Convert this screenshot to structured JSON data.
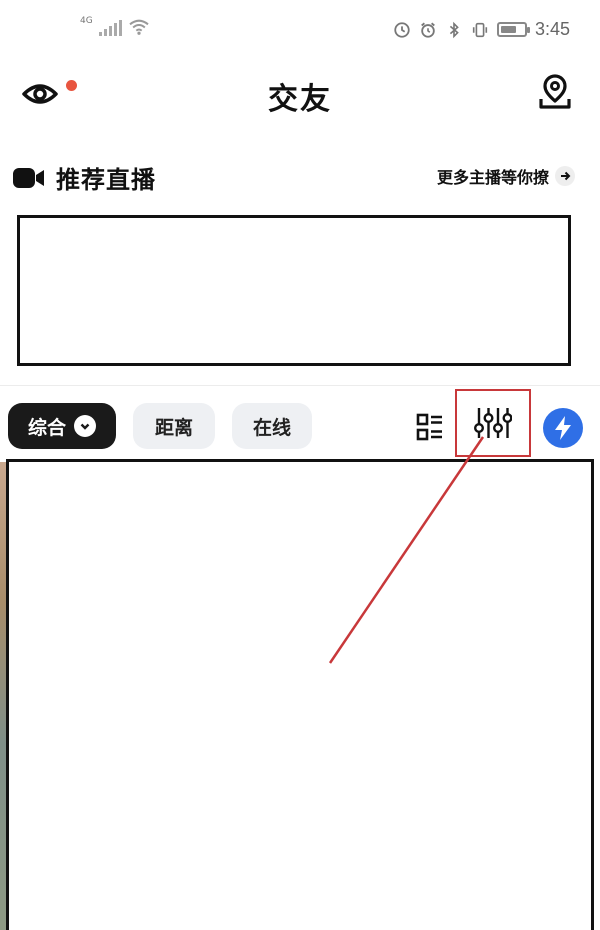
{
  "status_bar": {
    "network_type": "4G",
    "time": "3:45",
    "icons": [
      "signal-icon",
      "wifi-icon",
      "data-saver-icon",
      "alarm-icon",
      "bluetooth-icon",
      "vibrate-icon",
      "battery-icon"
    ],
    "battery_level": 0.7
  },
  "header": {
    "title": "交友",
    "left_icon": "eye-icon",
    "left_badge_color": "#e8553f",
    "right_icon": "location-pin-icon"
  },
  "live_section": {
    "title": "推荐直播",
    "more_link": "更多主播等你撩"
  },
  "filters": {
    "chips": [
      {
        "label": "综合",
        "active": true
      },
      {
        "label": "距离",
        "active": false
      },
      {
        "label": "在线",
        "active": false
      }
    ],
    "tools": [
      "grid-view-icon",
      "filter-sliders-icon",
      "flash-icon"
    ]
  },
  "colors": {
    "accent_blue": "#2f6fe6",
    "annotation_red": "#c8383a",
    "chip_active": "#1a1a1a",
    "chip_inactive": "#eef0f3"
  }
}
